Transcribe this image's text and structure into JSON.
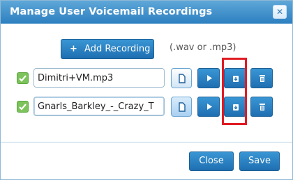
{
  "dialog": {
    "title": "Manage User Voicemail Recordings",
    "close_glyph": "✕"
  },
  "add_recording": {
    "label": "Add Recording",
    "icon": "plus-icon"
  },
  "format_hint": "(.wav or .mp3)",
  "recordings": [
    {
      "checked": true,
      "filename": "Dimitri+VM.mp3"
    },
    {
      "checked": true,
      "filename": "Gnarls_Barkley_-_Crazy_T"
    }
  ],
  "footer": {
    "close_label": "Close",
    "save_label": "Save"
  },
  "colors": {
    "accent": "#2c7fc0",
    "check": "#7cc35b",
    "highlight": "#e01b24"
  }
}
